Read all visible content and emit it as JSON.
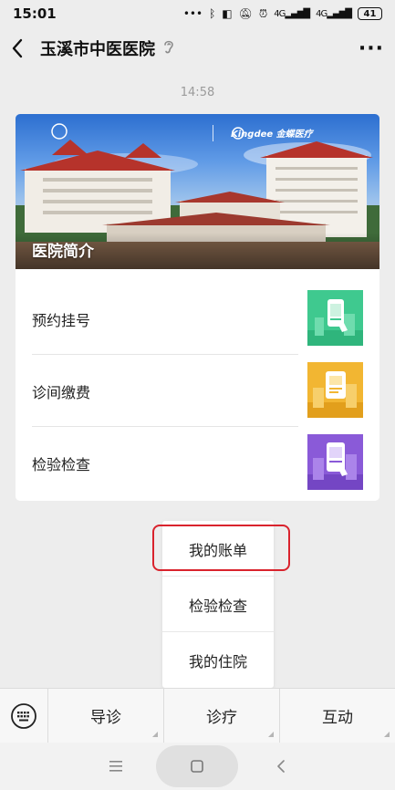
{
  "status_bar": {
    "time": "15:01",
    "network_1": "4G",
    "network_2": "4G",
    "battery": "41"
  },
  "nav": {
    "title": "玉溪市中医医院",
    "icons": [
      "back-icon",
      "ear-icon",
      "more-icon"
    ]
  },
  "chat": {
    "timestamp": "14:58"
  },
  "card": {
    "banner_title": "医院简介",
    "partner_brand": "Kingdee",
    "partner_name": "金蝶医疗",
    "items": [
      {
        "label": "预约挂号",
        "thumb_color": "#3fc98f"
      },
      {
        "label": "诊间缴费",
        "thumb_color": "#f2b632"
      },
      {
        "label": "检验检查",
        "thumb_color": "#8a5ad8"
      }
    ]
  },
  "popup": {
    "items": [
      "我的账单",
      "检验检查",
      "我的住院"
    ],
    "highlighted": "我的账单",
    "highlight_color": "#d9232d"
  },
  "menu_bar": {
    "tabs": [
      "导诊",
      "诊疗",
      "互动"
    ]
  }
}
